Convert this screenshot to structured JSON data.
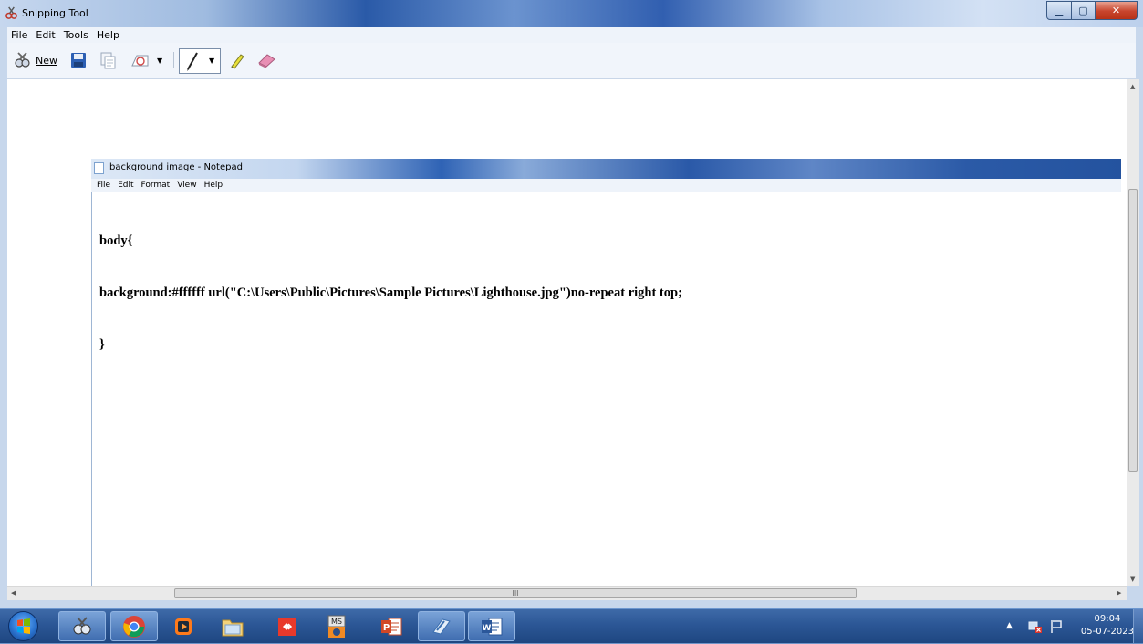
{
  "snipping_tool": {
    "title": "Snipping Tool",
    "menu": [
      "File",
      "Edit",
      "Tools",
      "Help"
    ],
    "toolbar": {
      "new_label": "New"
    }
  },
  "notepad": {
    "title": "background image - Notepad",
    "menu": [
      "File",
      "Edit",
      "Format",
      "View",
      "Help"
    ],
    "lines": [
      "body{",
      "background:#ffffff url(\"C:\\Users\\Public\\Pictures\\Sample Pictures\\Lighthouse.jpg\")no-repeat right top;",
      "}"
    ]
  },
  "taskbar": {
    "pinned": [
      "windows-start",
      "snipping-tool",
      "chrome",
      "media-player",
      "file-explorer",
      "anydesk",
      "ms-office-ms",
      "powerpoint",
      "paint",
      "word"
    ],
    "clock": {
      "time": "09:04",
      "date": "05-07-2023"
    }
  },
  "colors": {
    "titlebar_blue": "#2a5aa8",
    "taskbar": "#2c5796",
    "close_red": "#c8442c"
  }
}
